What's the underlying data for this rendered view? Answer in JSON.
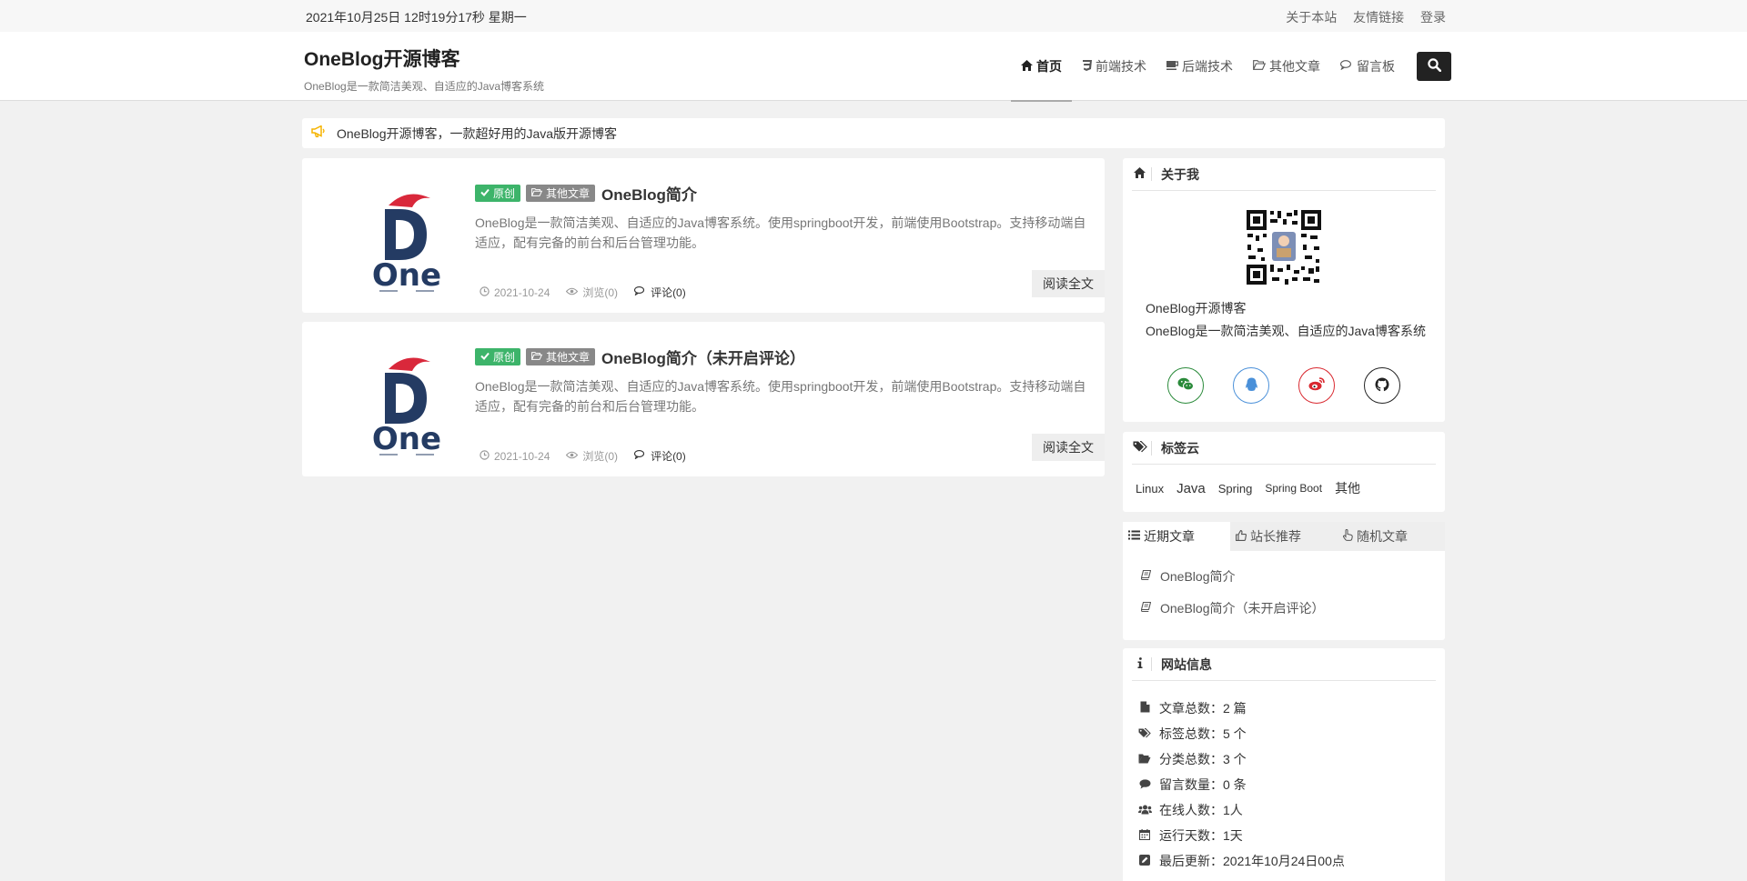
{
  "topbar": {
    "datetime": "2021年10月25日 12时19分17秒 星期一",
    "links": [
      "关于本站",
      "友情链接",
      "登录"
    ]
  },
  "header": {
    "title": "OneBlog开源博客",
    "subtitle": "OneBlog是一款简洁美观、自适应的Java博客系统",
    "nav": [
      {
        "label": "首页",
        "icon": "home-icon"
      },
      {
        "label": "前端技术",
        "icon": "css3-icon"
      },
      {
        "label": "后端技术",
        "icon": "coffee-icon"
      },
      {
        "label": "其他文章",
        "icon": "folder-open-icon"
      },
      {
        "label": "留言板",
        "icon": "comments-icon"
      }
    ]
  },
  "notice": {
    "text": "OneBlog开源博客，一款超好用的Java版开源博客"
  },
  "articles": [
    {
      "badge_original": "原创",
      "badge_category": "其他文章",
      "title": "OneBlog简介",
      "desc": "OneBlog是一款简洁美观、自适应的Java博客系统。使用springboot开发，前端使用Bootstrap。支持移动端自适应，配有完备的前台和后台管理功能。",
      "date": "2021-10-24",
      "views": "浏览(0)",
      "comments": "评论(0)",
      "read_more": "阅读全文"
    },
    {
      "badge_original": "原创",
      "badge_category": "其他文章",
      "title": "OneBlog简介（未开启评论）",
      "desc": "OneBlog是一款简洁美观、自适应的Java博客系统。使用springboot开发，前端使用Bootstrap。支持移动端自适应，配有完备的前台和后台管理功能。",
      "date": "2021-10-24",
      "views": "浏览(0)",
      "comments": "评论(0)",
      "read_more": "阅读全文"
    }
  ],
  "sidebar": {
    "about": {
      "title": "关于我",
      "name": "OneBlog开源博客",
      "intro": "OneBlog是一款简洁美观、自适应的Java博客系统",
      "socials": [
        {
          "icon": "wechat-icon",
          "color": "#2a8a3a"
        },
        {
          "icon": "qq-icon",
          "color": "#4a90d9"
        },
        {
          "icon": "weibo-icon",
          "color": "#d9282f"
        },
        {
          "icon": "github-icon",
          "color": "#222222"
        }
      ]
    },
    "tags": {
      "title": "标签云",
      "items": [
        "Linux",
        "Java",
        "Spring",
        "Spring Boot",
        "其他"
      ]
    },
    "tabs": {
      "labels": [
        "近期文章",
        "站长推荐",
        "随机文章"
      ],
      "recent": [
        "OneBlog简介",
        "OneBlog简介（未开启评论）"
      ]
    },
    "siteinfo": {
      "title": "网站信息",
      "items": [
        "文章总数：2 篇",
        "标签总数：5 个",
        "分类总数：3 个",
        "留言数量：0 条",
        "在线人数：1人",
        "运行天数：1天",
        "最后更新：2021年10月24日00点"
      ]
    }
  }
}
